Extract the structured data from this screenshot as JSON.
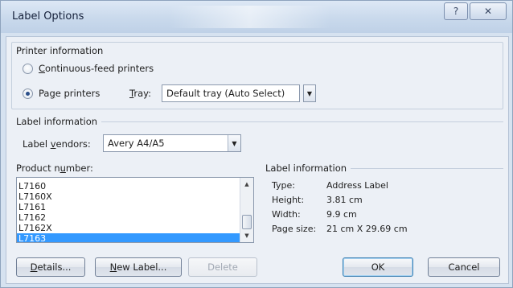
{
  "window": {
    "title": "Label Options",
    "help_glyph": "?",
    "close_glyph": "✕"
  },
  "printer_info": {
    "heading": "Printer information",
    "continuous": {
      "label_pre": "",
      "label_key": "C",
      "label_post": "ontinuous-feed printers",
      "checked": false
    },
    "page": {
      "label_pre": "Pa",
      "label_key": "g",
      "label_post": "e printers",
      "checked": true
    },
    "tray": {
      "label_key": "T",
      "label_post": "ray:",
      "value": "Default tray (Auto Select)"
    }
  },
  "label_info": {
    "heading": "Label information",
    "vendors": {
      "label_pre": "Label ",
      "label_key": "v",
      "label_post": "endors:",
      "value": "Avery A4/A5"
    }
  },
  "product": {
    "heading_pre": "Product n",
    "heading_key": "u",
    "heading_post": "mber:",
    "items": [
      "L7160",
      "L7160X",
      "L7161",
      "L7162",
      "L7162X",
      "L7163"
    ],
    "selected_index": 5
  },
  "details_panel": {
    "heading": "Label information",
    "rows": [
      {
        "key": "Type:",
        "value": "Address Label"
      },
      {
        "key": "Height:",
        "value": "3.81 cm"
      },
      {
        "key": "Width:",
        "value": "9.9 cm"
      },
      {
        "key": "Page size:",
        "value": "21 cm X 29.69 cm"
      }
    ]
  },
  "buttons": {
    "details": {
      "pre": "",
      "key": "D",
      "post": "etails..."
    },
    "new_label": {
      "pre": "",
      "key": "N",
      "post": "ew Label..."
    },
    "delete": "Delete",
    "ok": "OK",
    "cancel": "Cancel"
  },
  "icons": {
    "dropdown_arrow": "▼",
    "scroll_up": "▲",
    "scroll_down": "▼"
  }
}
